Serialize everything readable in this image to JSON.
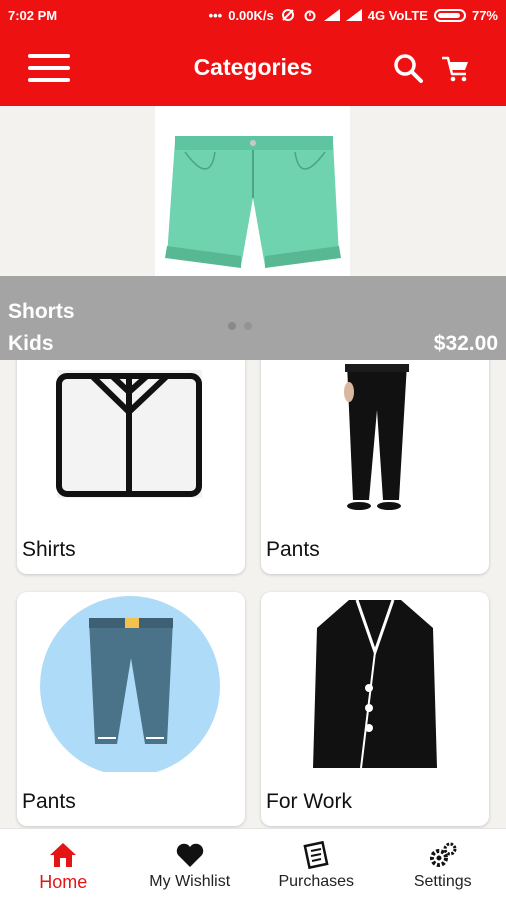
{
  "status_bar": {
    "time": "7:02 PM",
    "net_speed": "0.00K/s",
    "network": "4G VoLTE",
    "battery": "77%"
  },
  "app_bar": {
    "title": "Categories",
    "menu_icon": "hamburger-menu-icon",
    "search_icon": "search-icon",
    "cart_icon": "shopping-cart-icon"
  },
  "banner": {
    "product_name": "Shorts",
    "product_category": "Kids",
    "price": "$32.00",
    "image": "mint-green-denim-shorts"
  },
  "categories": [
    {
      "label": "Shirts",
      "image": "shirt-outline-icon"
    },
    {
      "label": "Pants",
      "image": "black-pants-photo"
    },
    {
      "label": "Pants",
      "image": "blue-jeans-icon"
    },
    {
      "label": "For Work",
      "image": "black-blazer-icon"
    }
  ],
  "bottom_nav": {
    "items": [
      {
        "label": "Home",
        "icon": "home-icon",
        "active": true
      },
      {
        "label": "My Wishlist",
        "icon": "heart-icon",
        "active": false
      },
      {
        "label": "Purchases",
        "icon": "receipt-icon",
        "active": false
      },
      {
        "label": "Settings",
        "icon": "gears-icon",
        "active": false
      }
    ]
  },
  "colors": {
    "primary": "#ee1111",
    "active_nav": "#e31515",
    "background": "#f3f2ef"
  }
}
